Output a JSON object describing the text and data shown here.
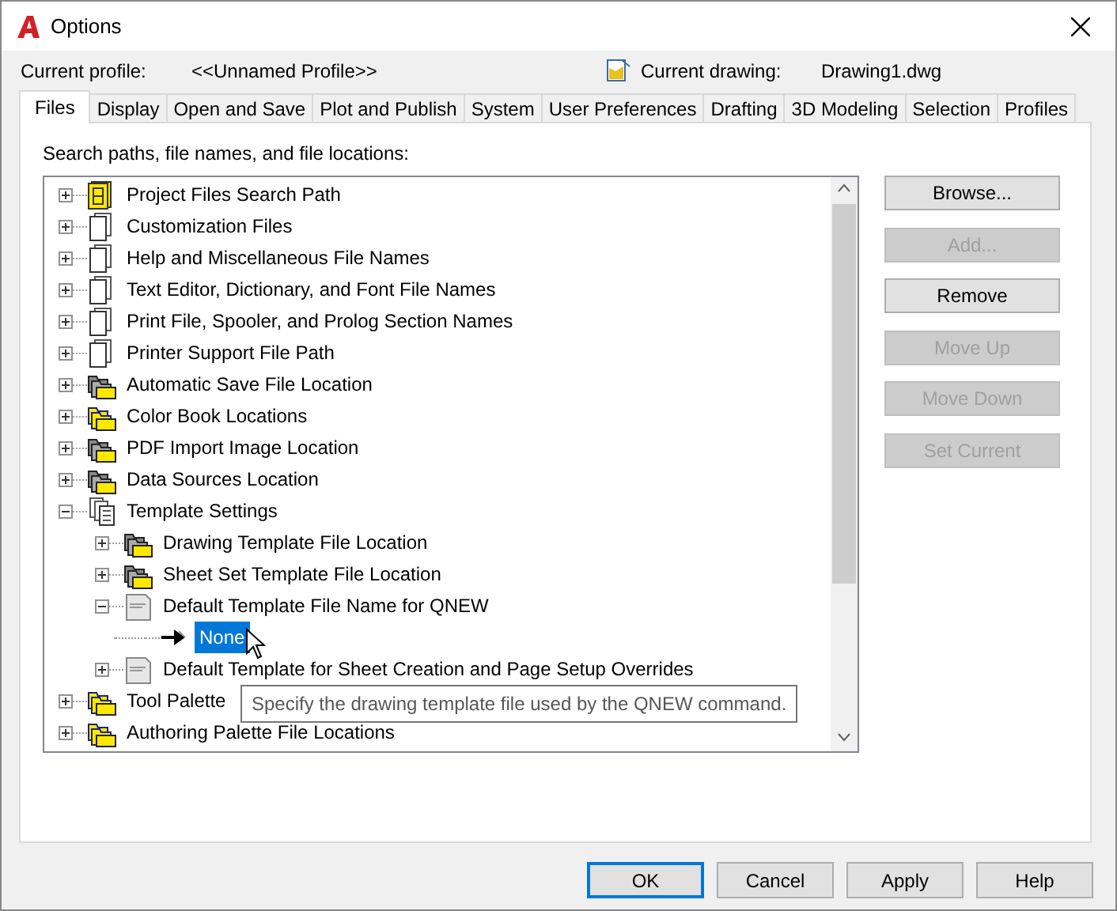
{
  "window": {
    "title": "Options"
  },
  "profile": {
    "label": "Current profile:",
    "value": "<<Unnamed Profile>>"
  },
  "drawing": {
    "label": "Current drawing:",
    "value": "Drawing1.dwg"
  },
  "tabs": [
    {
      "label": "Files",
      "selected": true
    },
    {
      "label": "Display",
      "selected": false
    },
    {
      "label": "Open and Save",
      "selected": false
    },
    {
      "label": "Plot and Publish",
      "selected": false
    },
    {
      "label": "System",
      "selected": false
    },
    {
      "label": "User Preferences",
      "selected": false
    },
    {
      "label": "Drafting",
      "selected": false
    },
    {
      "label": "3D Modeling",
      "selected": false
    },
    {
      "label": "Selection",
      "selected": false
    },
    {
      "label": "Profiles",
      "selected": false
    }
  ],
  "tree_label": "Search paths, file names, and file locations:",
  "tree": [
    {
      "label": "Project Files Search Path",
      "kind": "project",
      "expanded": false,
      "selected": false
    },
    {
      "label": "Customization Files",
      "kind": "doc",
      "expanded": false,
      "selected": false
    },
    {
      "label": "Help and Miscellaneous File Names",
      "kind": "doc",
      "expanded": false,
      "selected": false
    },
    {
      "label": "Text Editor, Dictionary, and Font File Names",
      "kind": "doc",
      "expanded": false,
      "selected": false
    },
    {
      "label": "Print File, Spooler, and Prolog Section Names",
      "kind": "doc",
      "expanded": false,
      "selected": false
    },
    {
      "label": "Printer Support File Path",
      "kind": "doc",
      "expanded": false,
      "selected": false
    },
    {
      "label": "Automatic Save File Location",
      "kind": "folder",
      "expanded": false,
      "selected": false
    },
    {
      "label": "Color Book Locations",
      "kind": "folder-alt",
      "expanded": false,
      "selected": false
    },
    {
      "label": "PDF Import Image Location",
      "kind": "folder",
      "expanded": false,
      "selected": false
    },
    {
      "label": "Data Sources Location",
      "kind": "folder",
      "expanded": false,
      "selected": false
    },
    {
      "label": "Template Settings",
      "kind": "template",
      "expanded": true,
      "selected": false,
      "children": [
        {
          "label": "Drawing Template File Location",
          "kind": "folder",
          "expanded": false,
          "selected": false
        },
        {
          "label": "Sheet Set Template File Location",
          "kind": "folder",
          "expanded": false,
          "selected": false
        },
        {
          "label": "Default Template File Name for QNEW",
          "kind": "dwt",
          "expanded": true,
          "selected": false,
          "children": [
            {
              "label": "None",
              "kind": "value",
              "selected": true
            }
          ]
        },
        {
          "label": "Default Template for Sheet Creation and Page Setup Overrides",
          "kind": "dwt",
          "expanded": false,
          "selected": false
        }
      ]
    },
    {
      "label": "Tool Palette",
      "kind": "folder-alt",
      "expanded": false,
      "selected": false
    },
    {
      "label": "Authoring Palette File Locations",
      "kind": "folder-alt",
      "expanded": false,
      "selected": false
    }
  ],
  "tooltip": "Specify the drawing template file used by the QNEW command.",
  "side_buttons": [
    {
      "label": "Browse...",
      "disabled": false
    },
    {
      "label": "Add...",
      "disabled": true
    },
    {
      "label": "Remove",
      "disabled": false
    },
    {
      "label": "Move Up",
      "disabled": true
    },
    {
      "label": "Move Down",
      "disabled": true
    },
    {
      "label": "Set Current",
      "disabled": true
    }
  ],
  "footer_buttons": [
    {
      "label": "OK",
      "default": true
    },
    {
      "label": "Cancel",
      "default": false
    },
    {
      "label": "Apply",
      "default": false
    },
    {
      "label": "Help",
      "default": false
    }
  ]
}
